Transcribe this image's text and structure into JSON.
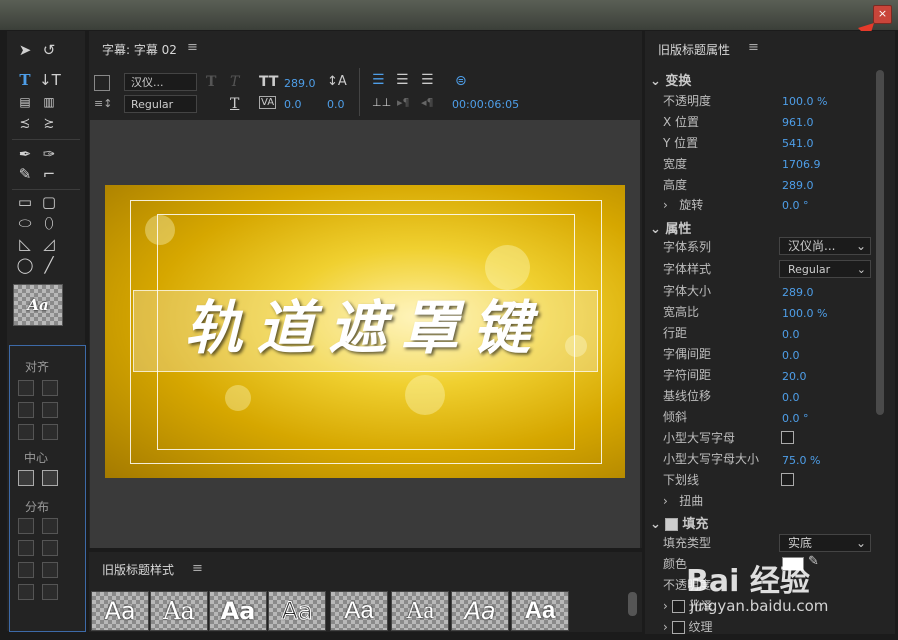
{
  "window": {
    "close_glyph": "×"
  },
  "toolbox": {
    "align_label": "对齐",
    "center_label": "中心",
    "distribute_label": "分布",
    "style_sample": "Aa"
  },
  "title_panel": {
    "title": "字幕: 字幕 02",
    "font_family": "汉仪...",
    "font_style": "Regular",
    "font_size": "289.0",
    "kerning": "0.0",
    "leading": "0.0",
    "tracking": "0.0",
    "timecode": "00:00:06:05",
    "title_text": "轨道遮罩键"
  },
  "styles_panel": {
    "title": "旧版标题样式",
    "swatches": [
      "Aa",
      "Aa",
      "Aa",
      "Aa",
      "Aa",
      "Aa",
      "Aa",
      "Aa"
    ]
  },
  "properties": {
    "title": "旧版标题属性",
    "transform": {
      "header": "变换",
      "opacity_label": "不透明度",
      "opacity": "100.0 %",
      "x_label": "X 位置",
      "x": "961.0",
      "y_label": "Y 位置",
      "y": "541.0",
      "width_label": "宽度",
      "width": "1706.9",
      "height_label": "高度",
      "height": "289.0",
      "rotation_label": "旋转",
      "rotation": "0.0 °"
    },
    "attributes": {
      "header": "属性",
      "family_label": "字体系列",
      "family": "汉仪尚...",
      "style_label": "字体样式",
      "style": "Regular",
      "size_label": "字体大小",
      "size": "289.0",
      "aspect_label": "宽高比",
      "aspect": "100.0 %",
      "leading_label": "行距",
      "leading": "0.0",
      "kerning_label": "字偶间距",
      "kerning": "0.0",
      "tracking_label": "字符间距",
      "tracking": "20.0",
      "baseline_label": "基线位移",
      "baseline": "0.0",
      "slant_label": "倾斜",
      "slant": "0.0 °",
      "smallcaps_label": "小型大写字母",
      "smallcaps_size_label": "小型大写字母大小",
      "smallcaps_size": "75.0 %",
      "underline_label": "下划线",
      "distort_label": "扭曲"
    },
    "fill": {
      "header": "填充",
      "type_label": "填充类型",
      "type": "实底",
      "color_label": "颜色",
      "opacity_label": "不透明度",
      "sheen_label": "光泽",
      "texture_label": "纹理"
    }
  },
  "watermark": {
    "logo": "Bai 经验",
    "url": "jingyan.baidu.com"
  },
  "colors": {
    "accent": "#4e9ee8",
    "panel": "#232323",
    "close": "#c9453a"
  }
}
